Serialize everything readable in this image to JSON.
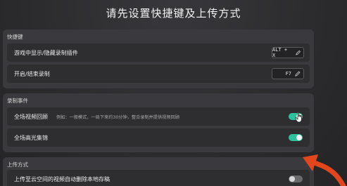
{
  "title": "请先设置快捷键及上传方式",
  "sections": {
    "hotkeys": {
      "title": "快捷键",
      "rows": [
        {
          "label": "游戏中显示/隐藏录制插件",
          "hotkey": "ALT + X"
        },
        {
          "label": "开启/结束录制",
          "hotkey": "F7"
        }
      ]
    },
    "recording": {
      "title": "录制事件",
      "rows": [
        {
          "label": "全场视频回顾",
          "desc": "例如：一般模式，一局下来约30分钟，整合录制并提供视频回顾",
          "toggle": "on"
        },
        {
          "label": "全场高光集锦",
          "toggle": "on"
        }
      ]
    },
    "upload": {
      "title": "上传方式",
      "rows": [
        {
          "label": "上传至云空间的视频自动删除本地存稿",
          "toggle": "off"
        }
      ]
    }
  },
  "colors": {
    "accent": "#2cc39a",
    "annotation_arrow": "#e2461c"
  }
}
